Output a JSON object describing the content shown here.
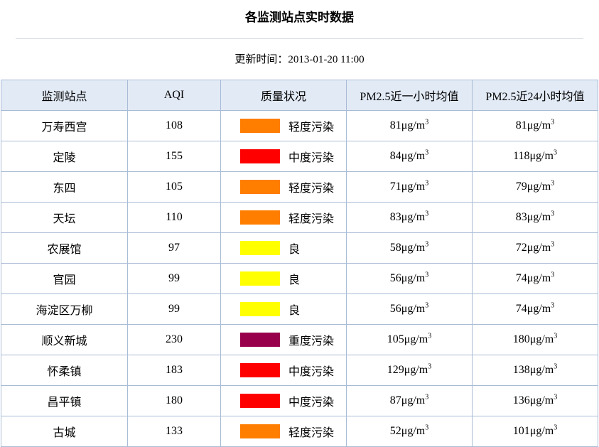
{
  "page": {
    "title": "各监测站点实时数据",
    "update_label": "更新时间：",
    "update_time": "2013-01-20 11:00"
  },
  "table": {
    "headers": [
      "监测站点",
      "AQI",
      "质量状况",
      "PM2.5近一小时均值",
      "PM2.5近24小时均值"
    ],
    "unit": "μg/m",
    "unit_sup": "3",
    "rows": [
      {
        "station": "万寿西宫",
        "aqi": "108",
        "quality": "轻度污染",
        "color": "#ff7e00",
        "pm_1h": "81",
        "pm_24h": "81"
      },
      {
        "station": "定陵",
        "aqi": "155",
        "quality": "中度污染",
        "color": "#ff0000",
        "pm_1h": "84",
        "pm_24h": "118"
      },
      {
        "station": "东四",
        "aqi": "105",
        "quality": "轻度污染",
        "color": "#ff7e00",
        "pm_1h": "71",
        "pm_24h": "79"
      },
      {
        "station": "天坛",
        "aqi": "110",
        "quality": "轻度污染",
        "color": "#ff7e00",
        "pm_1h": "83",
        "pm_24h": "83"
      },
      {
        "station": "农展馆",
        "aqi": "97",
        "quality": "良",
        "color": "#ffff00",
        "pm_1h": "58",
        "pm_24h": "72"
      },
      {
        "station": "官园",
        "aqi": "99",
        "quality": "良",
        "color": "#ffff00",
        "pm_1h": "56",
        "pm_24h": "74"
      },
      {
        "station": "海淀区万柳",
        "aqi": "99",
        "quality": "良",
        "color": "#ffff00",
        "pm_1h": "56",
        "pm_24h": "74"
      },
      {
        "station": "顺义新城",
        "aqi": "230",
        "quality": "重度污染",
        "color": "#99004c",
        "pm_1h": "105",
        "pm_24h": "180"
      },
      {
        "station": "怀柔镇",
        "aqi": "183",
        "quality": "中度污染",
        "color": "#ff0000",
        "pm_1h": "129",
        "pm_24h": "138"
      },
      {
        "station": "昌平镇",
        "aqi": "180",
        "quality": "中度污染",
        "color": "#ff0000",
        "pm_1h": "87",
        "pm_24h": "136"
      },
      {
        "station": "古城",
        "aqi": "133",
        "quality": "轻度污染",
        "color": "#ff7e00",
        "pm_1h": "52",
        "pm_24h": "101"
      }
    ]
  }
}
